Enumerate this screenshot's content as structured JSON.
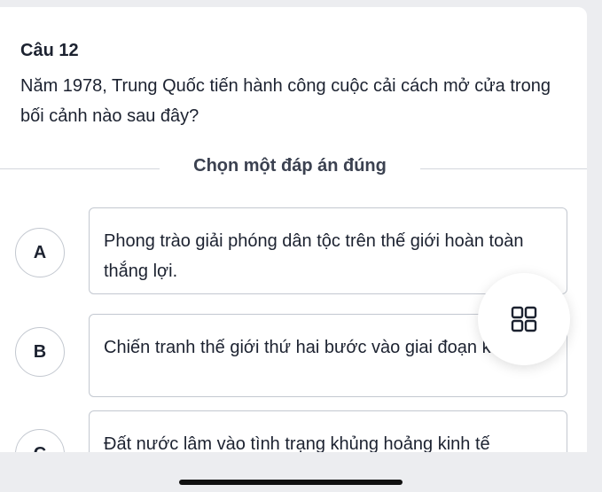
{
  "question": {
    "number_label": "Câu 12",
    "text": "Năm 1978, Trung Quốc tiến hành công cuộc cải cách mở cửa trong bối cảnh nào sau đây?"
  },
  "instruction": "Chọn một đáp án đúng",
  "options": [
    {
      "letter": "A",
      "text": "Phong trào giải phóng dân tộc trên thế giới hoàn toàn thắng lợi."
    },
    {
      "letter": "B",
      "text": "Chiến tranh thế giới thứ hai bước vào giai đoạn kết thúc."
    },
    {
      "letter": "C",
      "text": "Đất nước lâm vào tình trạng khủng hoảng kinh tế"
    }
  ],
  "floating_button": {
    "icon": "grid-icon"
  },
  "colors": {
    "border": "#c3c8d0",
    "text": "#1c2230",
    "background": "#ecedf0"
  }
}
